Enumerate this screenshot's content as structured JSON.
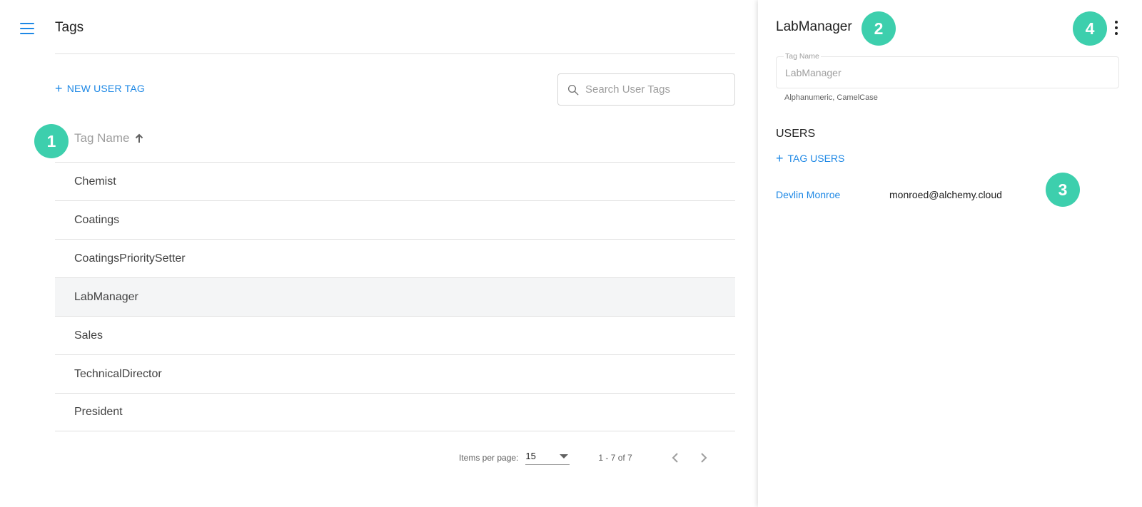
{
  "header": {
    "title": "Tags"
  },
  "toolbar": {
    "new_tag_label": "NEW USER TAG",
    "search_placeholder": "Search User Tags"
  },
  "table": {
    "column_header": "Tag Name",
    "rows": [
      {
        "name": "Chemist"
      },
      {
        "name": "Coatings"
      },
      {
        "name": "CoatingsPrioritySetter"
      },
      {
        "name": "LabManager",
        "selected": true
      },
      {
        "name": "Sales"
      },
      {
        "name": "TechnicalDirector"
      },
      {
        "name": "President"
      }
    ]
  },
  "paginator": {
    "items_per_page_label": "Items per page:",
    "items_per_page": "15",
    "range_label": "1 - 7 of 7"
  },
  "detail": {
    "title": "LabManager",
    "field_label": "Tag Name",
    "field_value": "LabManager",
    "field_hint": "Alphanumeric, CamelCase",
    "users_heading": "USERS",
    "tag_users_label": "TAG USERS",
    "users": [
      {
        "name": "Devlin Monroe",
        "email": "monroed@alchemy.cloud"
      }
    ]
  },
  "markers": [
    "1",
    "2",
    "3",
    "4"
  ],
  "colors": {
    "accent": "#1e88e5",
    "marker": "#3dcfad",
    "selected_row": "#f4f5f6"
  }
}
